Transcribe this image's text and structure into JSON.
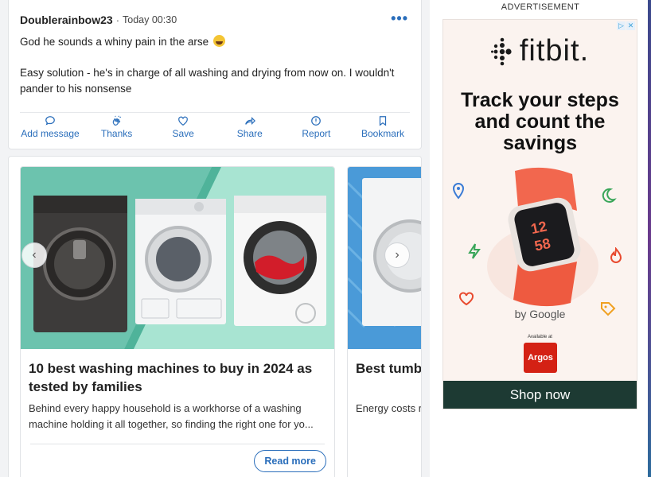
{
  "post": {
    "username": "Doublerainbow23",
    "separator": "·",
    "timestamp": "Today 00:30",
    "more_label": "•••",
    "body_line1": "God he sounds a whiny pain in the arse",
    "body_line2": "Easy solution - he's in charge of all washing and drying from now on. I wouldn't pander to his nonsense",
    "actions": [
      {
        "label": "Add message",
        "icon": "speech-bubble-icon"
      },
      {
        "label": "Thanks",
        "icon": "clapping-hands-icon"
      },
      {
        "label": "Save",
        "icon": "heart-icon"
      },
      {
        "label": "Share",
        "icon": "share-arrow-icon"
      },
      {
        "label": "Report",
        "icon": "report-icon"
      },
      {
        "label": "Bookmark",
        "icon": "bookmark-icon"
      }
    ]
  },
  "articles": [
    {
      "title": "10 best washing machines to buy in 2024 as tested by families",
      "description": "Behind every happy household is a workhorse of a washing machine holding it all together, so finding the right one for yo...",
      "button": "Read more"
    },
    {
      "title": "Best tumbl condenser",
      "description": "Energy costs r remain the mo"
    }
  ],
  "carousel": {
    "prev": "‹",
    "next": "›"
  },
  "ad": {
    "label": "ADVERTISEMENT",
    "brand": "fitbit",
    "brand_suffix": ".",
    "headline": "Track your steps and count the savings",
    "byline": "by Google",
    "available": "Available at",
    "retailer": "Argos",
    "cta": "Shop now",
    "watch_time_hours": "12",
    "watch_time_minutes": "58",
    "accent_color": "#f2674e",
    "cta_color": "#1d3a33"
  },
  "colors": {
    "link_blue": "#2a6ebb"
  }
}
